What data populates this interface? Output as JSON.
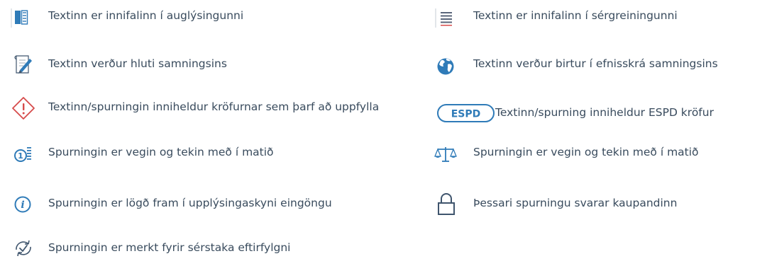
{
  "legend": {
    "items": [
      {
        "icon": "document-columns-icon",
        "label": "Textinn er innifalinn í auglýsingunni"
      },
      {
        "icon": "lines-document-icon",
        "label": "Textinn er innifalinn í sérgreiningunni"
      },
      {
        "icon": "contract-pen-icon",
        "label": "Textinn verður hluti samningsins"
      },
      {
        "icon": "globe-icon",
        "label": "Textinn verður birtur í efnisskrá samningsins"
      },
      {
        "icon": "warning-diamond-icon",
        "label": "Textinn/spurningin inniheldur kröfurnar sem þarf að uppfylla"
      },
      {
        "icon": "espd-badge-icon",
        "label": "Textinn/spurning inniheldur ESPD kröfur",
        "badge": "ESPD"
      },
      {
        "icon": "weighted-number-list-icon",
        "label": "Spurningin er vegin og tekin með í matið"
      },
      {
        "icon": "scales-icon",
        "label": "Spurningin er vegin og tekin með í matið"
      },
      {
        "icon": "info-circle-icon",
        "label": "Spurningin er lögð fram í upplýsingaskyni eingöngu"
      },
      {
        "icon": "padlock-icon",
        "label": "Þessari spurningu svarar kaupandinn"
      },
      {
        "icon": "refresh-check-icon",
        "label": "Spurningin er merkt fyrir sérstaka eftirfylgni"
      }
    ]
  },
  "colors": {
    "icon_blue": "#2f7bb8",
    "icon_dark": "#3f556d",
    "warning_red": "#d64b4b",
    "text": "#394b5d"
  }
}
